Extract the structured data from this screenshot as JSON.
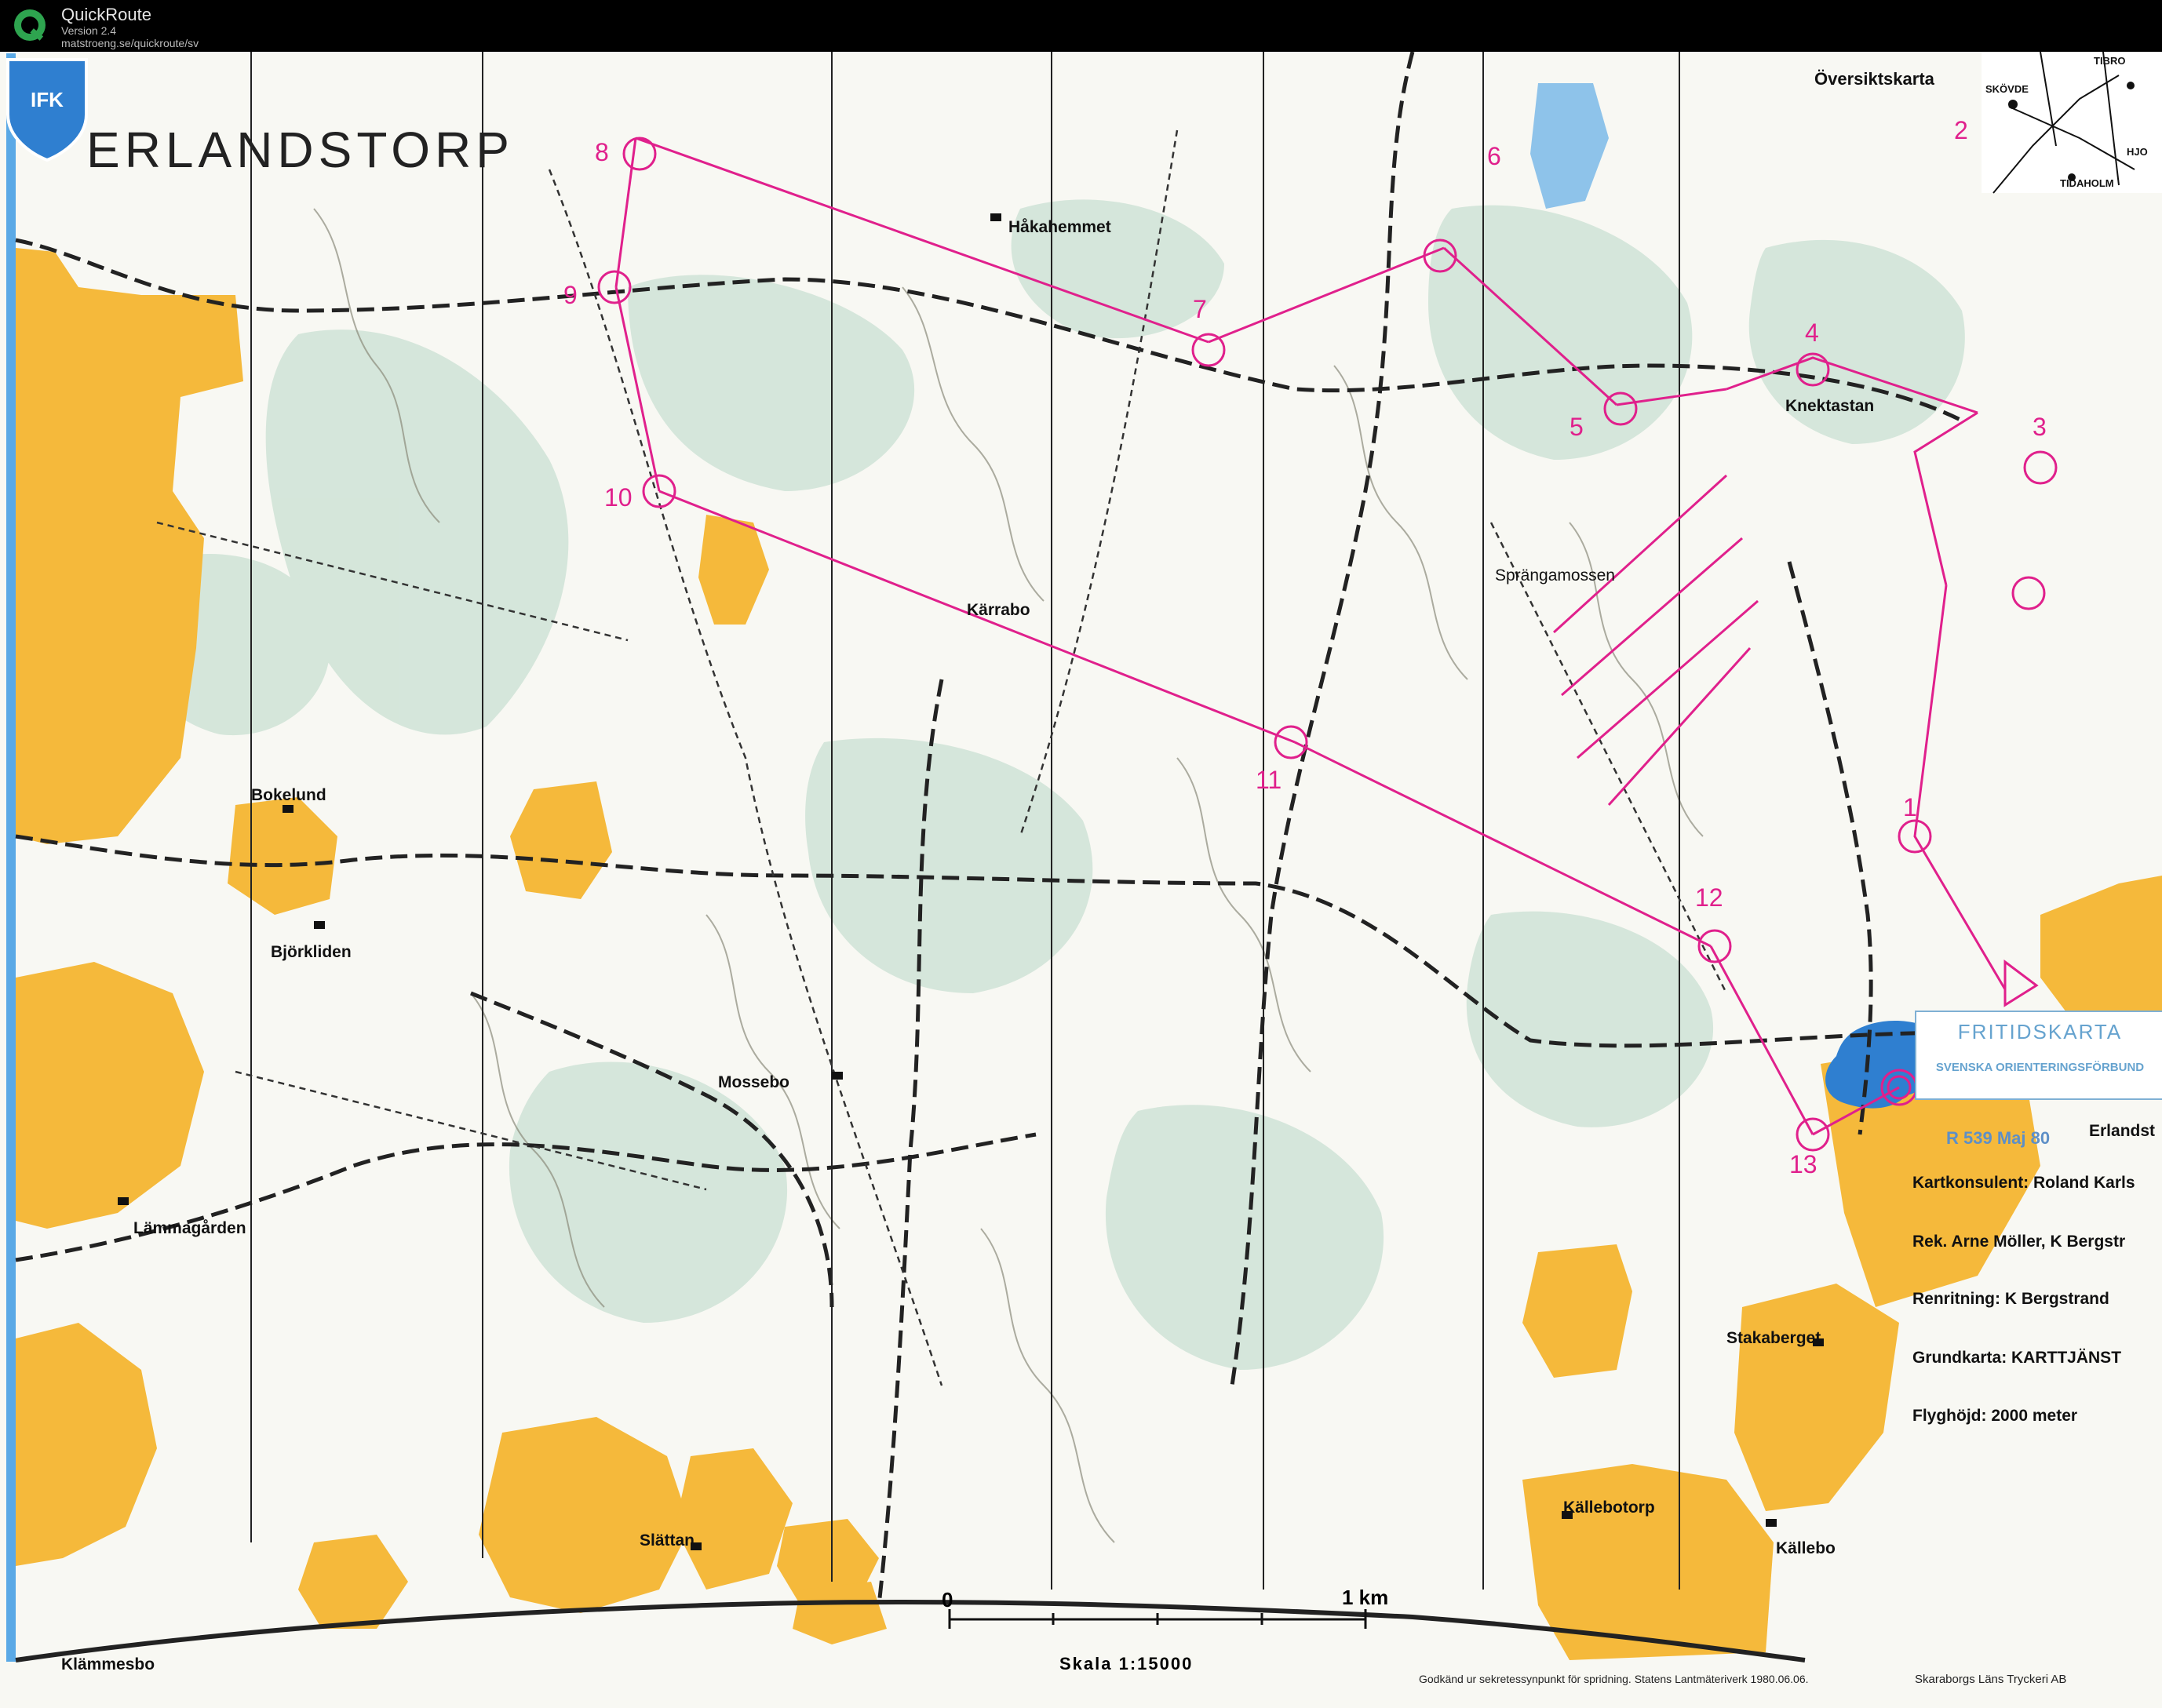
{
  "window": {
    "app_name": "QuickRoute",
    "version": "Version 2.4",
    "url": "matstroeng.se/quickroute/sv"
  },
  "map": {
    "title": "ERLANDSTORP",
    "overview_label": "Översiktskarta",
    "overview_places": [
      "TIBRO",
      "SKÖVDE",
      "HJO",
      "TIDAHOLM"
    ],
    "places": [
      {
        "id": "hakahemmet",
        "name": "Håkahemmet"
      },
      {
        "id": "knektastan",
        "name": "Knektastan"
      },
      {
        "id": "sprangamossen",
        "name": "Sprängamossen"
      },
      {
        "id": "karrabo",
        "name": "Kärrabo"
      },
      {
        "id": "bokelund",
        "name": "Bokelund"
      },
      {
        "id": "bjorkliden",
        "name": "Björkliden"
      },
      {
        "id": "mossebo",
        "name": "Mossebo"
      },
      {
        "id": "lammagarden",
        "name": "Lämmagården"
      },
      {
        "id": "stakaberget",
        "name": "Stakaberget"
      },
      {
        "id": "kallebotorp",
        "name": "Källebotorp"
      },
      {
        "id": "kallebo",
        "name": "Källebo"
      },
      {
        "id": "slattan",
        "name": "Slättan"
      },
      {
        "id": "klammesbo",
        "name": "Klämmesbo"
      },
      {
        "id": "erlandstorp-edge",
        "name": "Erlandst"
      }
    ],
    "controls": [
      "1",
      "2",
      "3",
      "4",
      "5",
      "6",
      "7",
      "8",
      "9",
      "10",
      "11",
      "12",
      "13"
    ],
    "badge_text": "IFK",
    "scale": {
      "zero": "0",
      "km": "1 km",
      "text": "Skala  1:15000"
    },
    "info": {
      "fritid_title": "FRITIDSKARTA",
      "fritid_sub": "SVENSKA  ORIENTERINGSFÖRBUND",
      "rnum": "R 539  Maj  80",
      "lines": [
        "Kartkonsulent: Roland Karls",
        "Rek.  Arne Möller,   K Bergstr",
        "Renritning:    K Bergstrand",
        "Grundkarta: KARTTJÄNST",
        "Flyghöjd:  2000 meter"
      ]
    },
    "approval_text": "Godkänd ur sekretessynpunkt för spridning.  Statens Lantmäteriverk 1980.06.06.",
    "printer_text": "Skaraborgs Läns Tryckeri AB"
  },
  "colors": {
    "field": "#f5b93b",
    "green": "#cfe3d6",
    "water": "#2f7fd0",
    "course": "#e0208c",
    "contour": "#8a8a7a"
  }
}
